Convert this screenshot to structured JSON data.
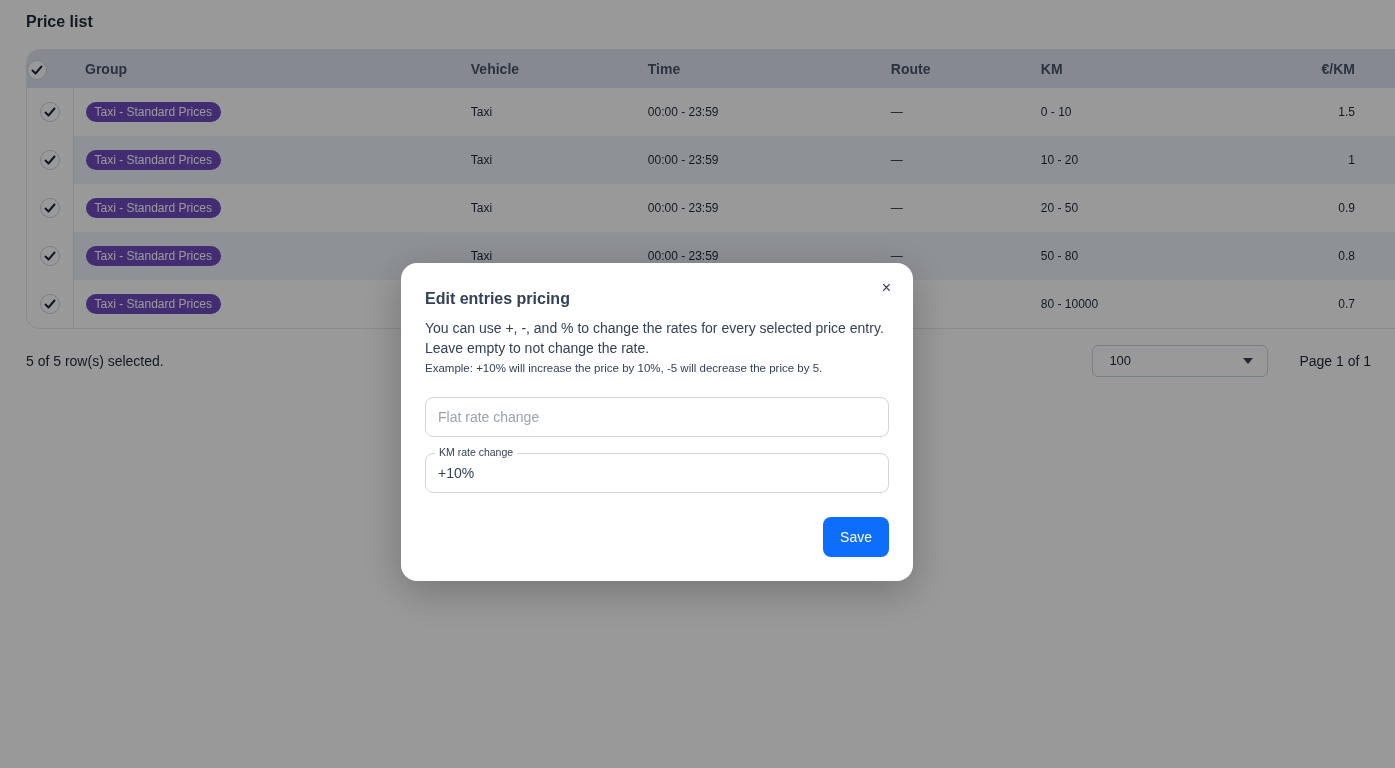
{
  "page": {
    "title": "Price list"
  },
  "table": {
    "all_selected": true,
    "columns": [
      "Group",
      "Vehicle",
      "Time",
      "Route",
      "KM",
      "€/KM"
    ],
    "rows": [
      {
        "selected": true,
        "group": "Taxi - Standard Prices",
        "vehicle": "Taxi",
        "time": "00:00 - 23:59",
        "route": "—",
        "km": "0 - 10",
        "rate": "1.5"
      },
      {
        "selected": true,
        "group": "Taxi - Standard Prices",
        "vehicle": "Taxi",
        "time": "00:00 - 23:59",
        "route": "—",
        "km": "10 - 20",
        "rate": "1"
      },
      {
        "selected": true,
        "group": "Taxi - Standard Prices",
        "vehicle": "Taxi",
        "time": "00:00 - 23:59",
        "route": "—",
        "km": "20 - 50",
        "rate": "0.9"
      },
      {
        "selected": true,
        "group": "Taxi - Standard Prices",
        "vehicle": "Taxi",
        "time": "00:00 - 23:59",
        "route": "—",
        "km": "50 - 80",
        "rate": "0.8"
      },
      {
        "selected": true,
        "group": "Taxi - Standard Prices",
        "km": "80 - 10000",
        "rate": "0.7"
      }
    ]
  },
  "footer": {
    "selection": "5 of 5 row(s) selected.",
    "page_size": "100",
    "page": "Page 1 of 1"
  },
  "dialog": {
    "title": "Edit entries pricing",
    "close": "×",
    "description": "You can use +, -, and % to change the rates for every selected price entry. Leave empty to not change the rate.",
    "example": "Example: +10% will increase the price by 10%, -5 will decrease the price by 5.",
    "fields": [
      {
        "placeholder": "Flat rate change"
      },
      {
        "label": "KM rate change",
        "value": "+10%"
      }
    ],
    "save": "Save"
  }
}
